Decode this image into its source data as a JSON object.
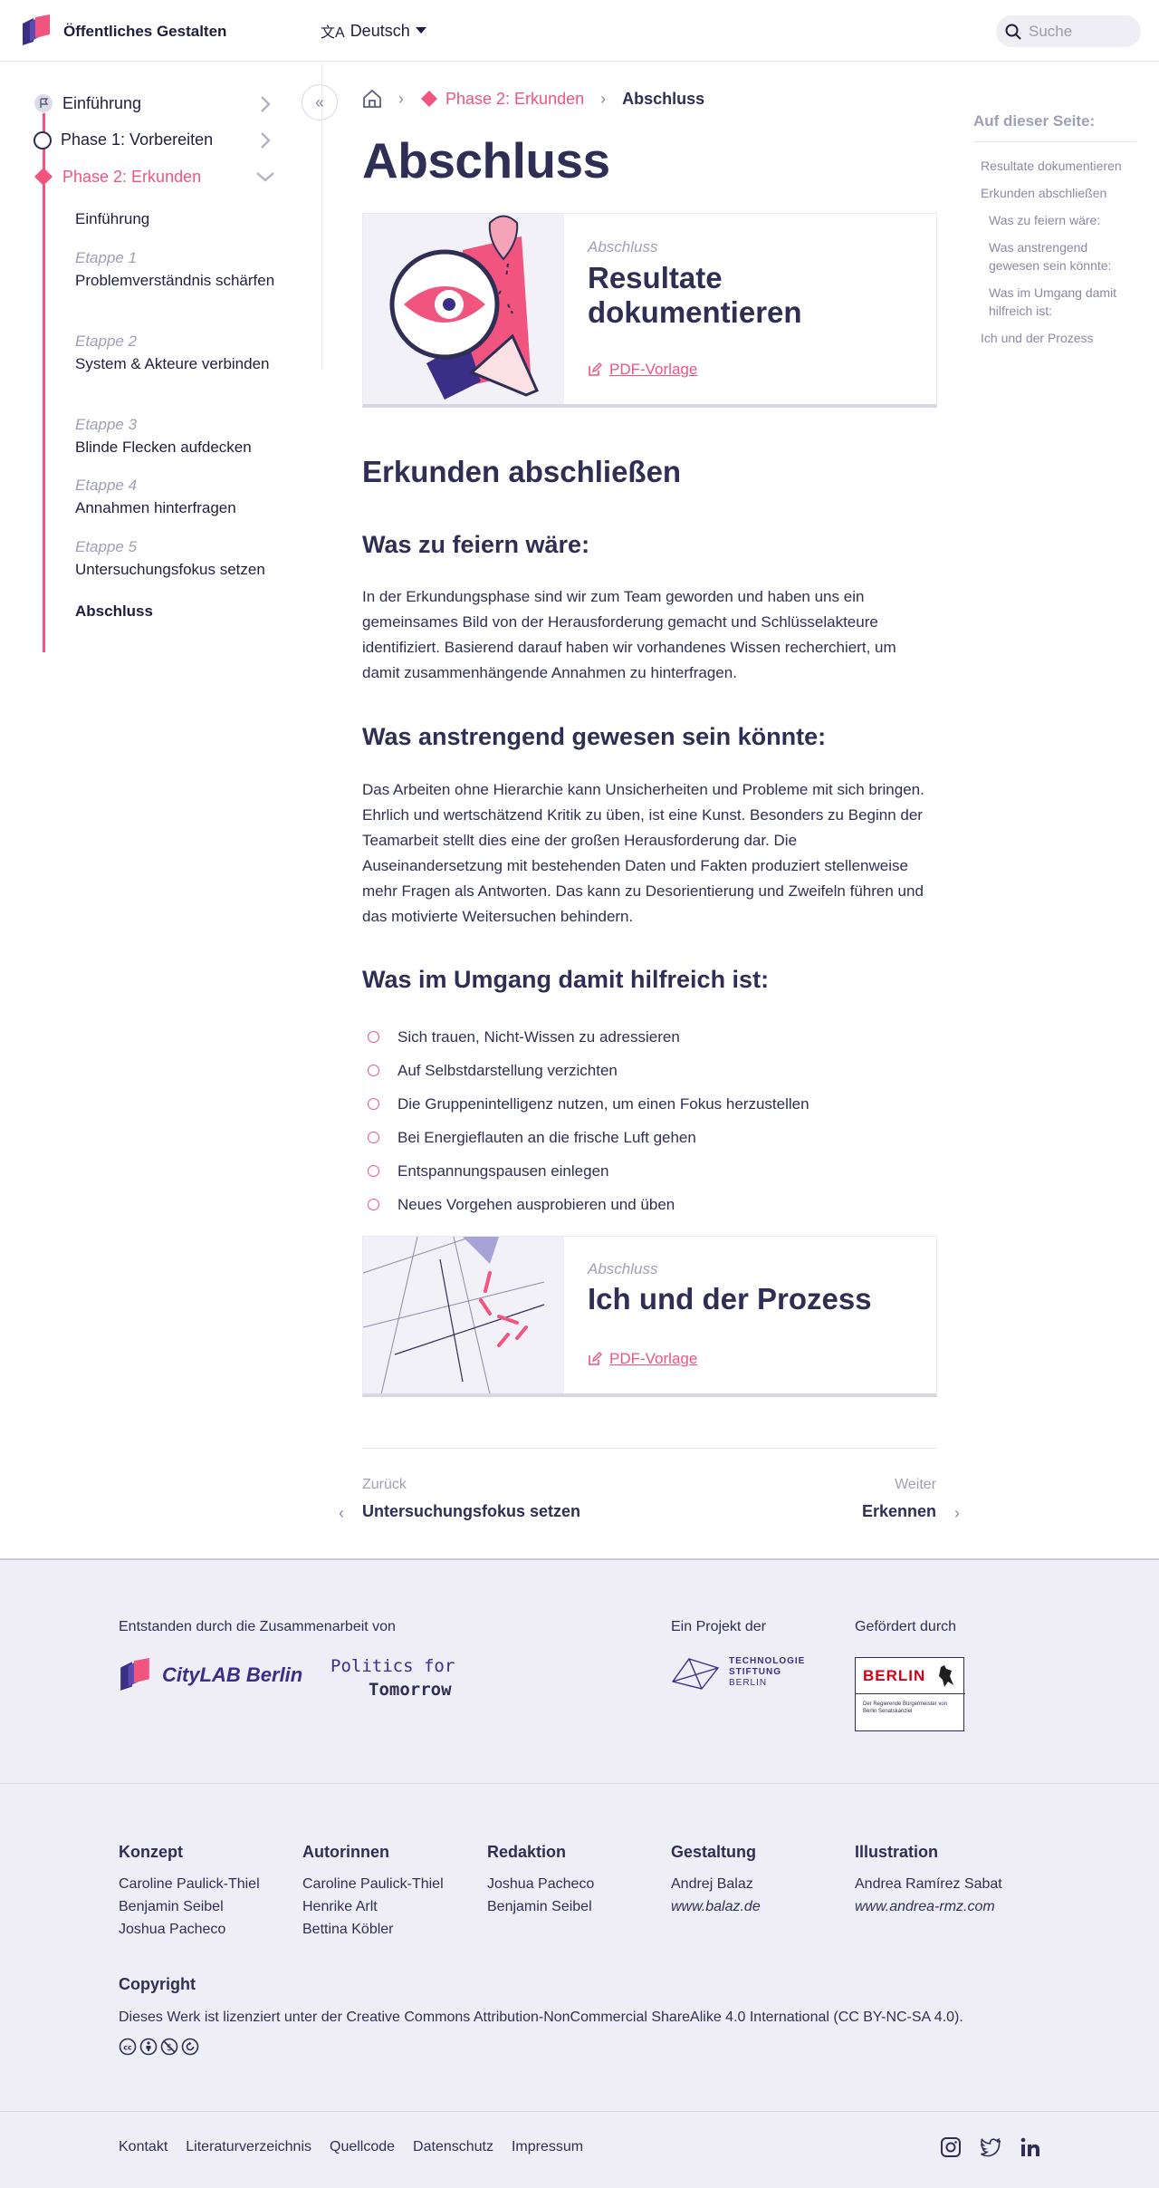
{
  "header": {
    "site_title": "Öffentliches Gestalten",
    "language": "Deutsch",
    "search_placeholder": "Suche"
  },
  "sidebar": {
    "items": [
      {
        "label": "Einführung"
      },
      {
        "label": "Phase 1: Vorbereiten"
      },
      {
        "label": "Phase 2: Erkunden"
      }
    ],
    "sub_intro": "Einführung",
    "steps": [
      {
        "label": "Etappe 1",
        "title": "Problemverständnis schärfen"
      },
      {
        "label": "Etappe 2",
        "title": "System & Akteure verbinden"
      },
      {
        "label": "Etappe 3",
        "title": "Blinde Flecken aufdecken"
      },
      {
        "label": "Etappe 4",
        "title": "Annahmen hinterfragen"
      },
      {
        "label": "Etappe 5",
        "title": "Untersuchungsfokus setzen"
      }
    ],
    "sub_final": "Abschluss"
  },
  "breadcrumb": {
    "phase": "Phase 2: Erkunden",
    "current": "Abschluss"
  },
  "main": {
    "title": "Abschluss",
    "card1": {
      "kicker": "Abschluss",
      "title": "Resultate dokumentieren",
      "pdf": "PDF-Vorlage"
    },
    "section_title": "Erkunden abschließen",
    "h_celebrate": "Was zu feiern wäre:",
    "p_celebrate": "In der Erkundungsphase sind wir zum Team geworden und haben uns ein gemeinsames Bild von der Herausforderung gemacht und Schlüsselakteure identifiziert. Basierend darauf haben wir vorhandenes Wissen recherchiert, um damit zusammenhängende Annahmen zu hinterfragen.",
    "h_hard": "Was anstrengend gewesen sein könnte:",
    "p_hard": "Das Arbeiten ohne Hierarchie kann Unsicherheiten und Probleme mit sich bringen. Ehrlich und wertschätzend Kritik zu üben, ist eine Kunst. Besonders zu Beginn der Teamarbeit stellt dies eine der großen Herausforderung dar. Die Auseinandersetzung mit bestehenden Daten und Fakten produziert stellenweise mehr Fragen als Antworten. Das kann zu Desorientierung und Zweifeln führen und das motivierte Weitersuchen behindern.",
    "h_help": "Was im Umgang damit hilfreich ist:",
    "bullets": [
      "Sich trauen, Nicht-Wissen zu adressieren",
      "Auf Selbstdarstellung verzichten",
      "Die Gruppenintelligenz nutzen, um einen Fokus herzustellen",
      "Bei Energieflauten an die frische Luft gehen",
      "Entspannungspausen einlegen",
      "Neues Vorgehen ausprobieren und üben"
    ],
    "card2": {
      "kicker": "Abschluss",
      "title": "Ich und der Prozess",
      "pdf": "PDF-Vorlage"
    }
  },
  "pager": {
    "prev_label": "Zurück",
    "prev_title": "Untersuchungsfokus setzen",
    "next_label": "Weiter",
    "next_title": "Erkennen"
  },
  "toc": {
    "title": "Auf dieser Seite:",
    "items": [
      "Resultate dokumentieren",
      "Erkunden abschließen",
      "Was zu feiern wäre:",
      "Was anstrengend gewesen sein könnte:",
      "Was im Umgang damit hilfreich ist:",
      "Ich und der Prozess"
    ]
  },
  "footer": {
    "collab_label": "Entstanden durch die Zusammenarbeit von",
    "citylab": "CityLAB Berlin",
    "politics_line1": "Politics for",
    "politics_line2": "Tomorrow",
    "project_label": "Ein Projekt der",
    "tsb_line1": "TECHNOLOGIE",
    "tsb_line2": "STIFTUNG",
    "tsb_line3": "BERLIN",
    "funded_label": "Gefördert durch",
    "berlin": "BERLIN",
    "berlin_small": "Der Regierende Bürgermeister von Berlin Senatskanzlei",
    "credits": [
      {
        "head": "Konzept",
        "lines": [
          "Caroline Paulick-Thiel",
          "Benjamin Seibel",
          "Joshua Pacheco"
        ]
      },
      {
        "head": "Autorinnen",
        "lines": [
          "Caroline Paulick-Thiel",
          "Henrike Arlt",
          "Bettina Köbler"
        ]
      },
      {
        "head": "Redaktion",
        "lines": [
          "Joshua Pacheco",
          "Benjamin Seibel"
        ]
      },
      {
        "head": "Gestaltung",
        "lines": [
          "Andrej Balaz",
          "www.balaz.de"
        ]
      },
      {
        "head": "Illustration",
        "lines": [
          "Andrea Ramírez Sabat",
          "www.andrea-rmz.com"
        ]
      }
    ],
    "copyright_head": "Copyright",
    "copyright_text": "Dieses Werk ist lizenziert unter der Creative Commons Attribution-NonCommercial ShareAlike 4.0 International (CC BY-NC-SA 4.0).",
    "links": [
      "Kontakt",
      "Literaturverzeichnis",
      "Quellcode",
      "Datenschutz",
      "Impressum"
    ]
  },
  "colors": {
    "accent": "#f0547f",
    "text": "#2f2f55",
    "muted": "#9f9fb5",
    "footer_bg": "#efeef7"
  }
}
